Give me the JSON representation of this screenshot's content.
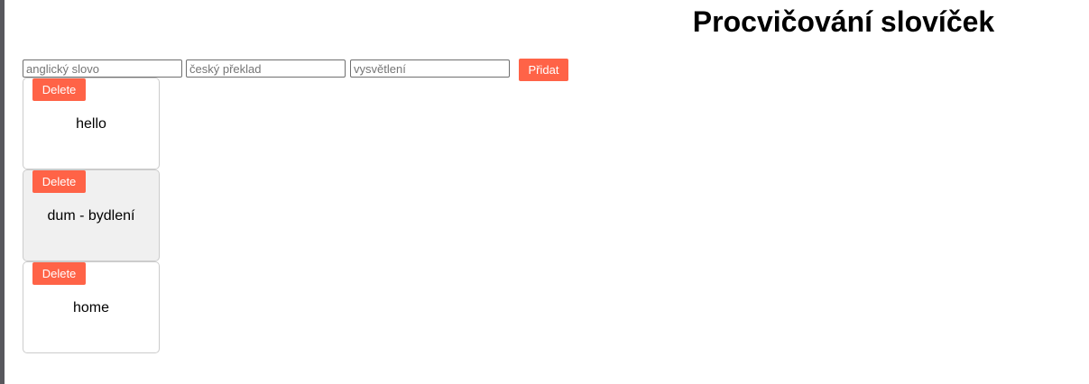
{
  "page": {
    "title": "Procvičování slovíček"
  },
  "form": {
    "english_placeholder": "anglický slovo",
    "czech_placeholder": "český překlad",
    "description_placeholder": "vysvětlení",
    "add_label": "Přidat"
  },
  "cards": [
    {
      "delete_label": "Delete",
      "text": "hello",
      "highlighted": false
    },
    {
      "delete_label": "Delete",
      "text": "dum - bydlení",
      "highlighted": true
    },
    {
      "delete_label": "Delete",
      "text": "home",
      "highlighted": false
    }
  ],
  "colors": {
    "accent": "#ff6347",
    "card_border": "#cccccc",
    "card_highlight_bg": "#f0f0f0",
    "window_edge": "#58585d"
  }
}
